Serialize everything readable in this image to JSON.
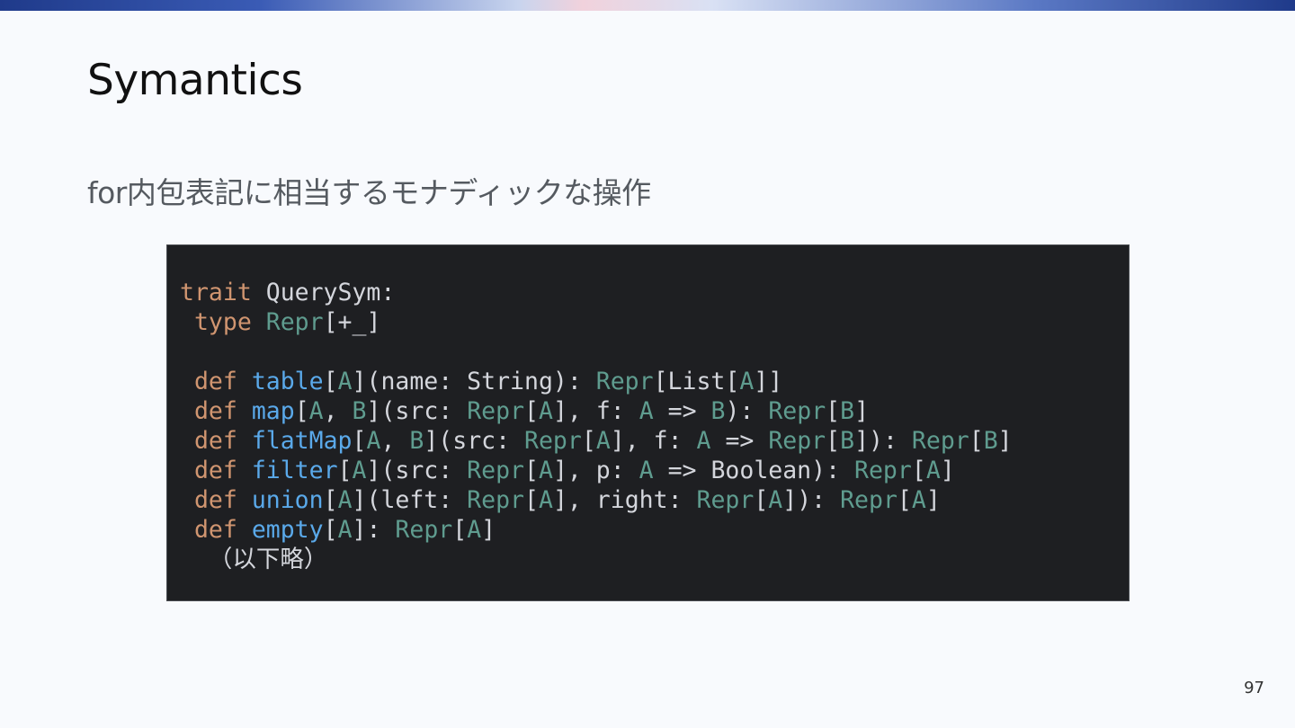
{
  "slide": {
    "title": "Symantics",
    "subtitle": "for内包表記に相当するモナディックな操作",
    "page_number": "97"
  },
  "code": {
    "lines": [
      [
        {
          "t": "trait",
          "c": "kw"
        },
        {
          "t": " QuerySym:",
          "c": "pl"
        }
      ],
      [
        {
          "t": " ",
          "c": "pl"
        },
        {
          "t": "type",
          "c": "kw"
        },
        {
          "t": " ",
          "c": "pl"
        },
        {
          "t": "Repr",
          "c": "ty"
        },
        {
          "t": "[+_]",
          "c": "pl"
        }
      ],
      [],
      [
        {
          "t": " ",
          "c": "pl"
        },
        {
          "t": "def",
          "c": "kw"
        },
        {
          "t": " ",
          "c": "pl"
        },
        {
          "t": "table",
          "c": "fn"
        },
        {
          "t": "[",
          "c": "pl"
        },
        {
          "t": "A",
          "c": "ty"
        },
        {
          "t": "](name: String): ",
          "c": "pl"
        },
        {
          "t": "Repr",
          "c": "ty"
        },
        {
          "t": "[List[",
          "c": "pl"
        },
        {
          "t": "A",
          "c": "ty"
        },
        {
          "t": "]]",
          "c": "pl"
        }
      ],
      [
        {
          "t": " ",
          "c": "pl"
        },
        {
          "t": "def",
          "c": "kw"
        },
        {
          "t": " ",
          "c": "pl"
        },
        {
          "t": "map",
          "c": "fn"
        },
        {
          "t": "[",
          "c": "pl"
        },
        {
          "t": "A",
          "c": "ty"
        },
        {
          "t": ", ",
          "c": "pl"
        },
        {
          "t": "B",
          "c": "ty"
        },
        {
          "t": "](src: ",
          "c": "pl"
        },
        {
          "t": "Repr",
          "c": "ty"
        },
        {
          "t": "[",
          "c": "pl"
        },
        {
          "t": "A",
          "c": "ty"
        },
        {
          "t": "], f: ",
          "c": "pl"
        },
        {
          "t": "A",
          "c": "ty"
        },
        {
          "t": " => ",
          "c": "pl"
        },
        {
          "t": "B",
          "c": "ty"
        },
        {
          "t": "): ",
          "c": "pl"
        },
        {
          "t": "Repr",
          "c": "ty"
        },
        {
          "t": "[",
          "c": "pl"
        },
        {
          "t": "B",
          "c": "ty"
        },
        {
          "t": "]",
          "c": "pl"
        }
      ],
      [
        {
          "t": " ",
          "c": "pl"
        },
        {
          "t": "def",
          "c": "kw"
        },
        {
          "t": " ",
          "c": "pl"
        },
        {
          "t": "flatMap",
          "c": "fn"
        },
        {
          "t": "[",
          "c": "pl"
        },
        {
          "t": "A",
          "c": "ty"
        },
        {
          "t": ", ",
          "c": "pl"
        },
        {
          "t": "B",
          "c": "ty"
        },
        {
          "t": "](src: ",
          "c": "pl"
        },
        {
          "t": "Repr",
          "c": "ty"
        },
        {
          "t": "[",
          "c": "pl"
        },
        {
          "t": "A",
          "c": "ty"
        },
        {
          "t": "], f: ",
          "c": "pl"
        },
        {
          "t": "A",
          "c": "ty"
        },
        {
          "t": " => ",
          "c": "pl"
        },
        {
          "t": "Repr",
          "c": "ty"
        },
        {
          "t": "[",
          "c": "pl"
        },
        {
          "t": "B",
          "c": "ty"
        },
        {
          "t": "]): ",
          "c": "pl"
        },
        {
          "t": "Repr",
          "c": "ty"
        },
        {
          "t": "[",
          "c": "pl"
        },
        {
          "t": "B",
          "c": "ty"
        },
        {
          "t": "]",
          "c": "pl"
        }
      ],
      [
        {
          "t": " ",
          "c": "pl"
        },
        {
          "t": "def",
          "c": "kw"
        },
        {
          "t": " ",
          "c": "pl"
        },
        {
          "t": "filter",
          "c": "fn"
        },
        {
          "t": "[",
          "c": "pl"
        },
        {
          "t": "A",
          "c": "ty"
        },
        {
          "t": "](src: ",
          "c": "pl"
        },
        {
          "t": "Repr",
          "c": "ty"
        },
        {
          "t": "[",
          "c": "pl"
        },
        {
          "t": "A",
          "c": "ty"
        },
        {
          "t": "], p: ",
          "c": "pl"
        },
        {
          "t": "A",
          "c": "ty"
        },
        {
          "t": " => Boolean): ",
          "c": "pl"
        },
        {
          "t": "Repr",
          "c": "ty"
        },
        {
          "t": "[",
          "c": "pl"
        },
        {
          "t": "A",
          "c": "ty"
        },
        {
          "t": "]",
          "c": "pl"
        }
      ],
      [
        {
          "t": " ",
          "c": "pl"
        },
        {
          "t": "def",
          "c": "kw"
        },
        {
          "t": " ",
          "c": "pl"
        },
        {
          "t": "union",
          "c": "fn"
        },
        {
          "t": "[",
          "c": "pl"
        },
        {
          "t": "A",
          "c": "ty"
        },
        {
          "t": "](left: ",
          "c": "pl"
        },
        {
          "t": "Repr",
          "c": "ty"
        },
        {
          "t": "[",
          "c": "pl"
        },
        {
          "t": "A",
          "c": "ty"
        },
        {
          "t": "], right: ",
          "c": "pl"
        },
        {
          "t": "Repr",
          "c": "ty"
        },
        {
          "t": "[",
          "c": "pl"
        },
        {
          "t": "A",
          "c": "ty"
        },
        {
          "t": "]): ",
          "c": "pl"
        },
        {
          "t": "Repr",
          "c": "ty"
        },
        {
          "t": "[",
          "c": "pl"
        },
        {
          "t": "A",
          "c": "ty"
        },
        {
          "t": "]",
          "c": "pl"
        }
      ],
      [
        {
          "t": " ",
          "c": "pl"
        },
        {
          "t": "def",
          "c": "kw"
        },
        {
          "t": " ",
          "c": "pl"
        },
        {
          "t": "empty",
          "c": "fn"
        },
        {
          "t": "[",
          "c": "pl"
        },
        {
          "t": "A",
          "c": "ty"
        },
        {
          "t": "]: ",
          "c": "pl"
        },
        {
          "t": "Repr",
          "c": "ty"
        },
        {
          "t": "[",
          "c": "pl"
        },
        {
          "t": "A",
          "c": "ty"
        },
        {
          "t": "]",
          "c": "pl"
        }
      ],
      [
        {
          "t": "  （以下略）",
          "c": "pl"
        }
      ]
    ]
  },
  "colors": {
    "background": "#f8fafd",
    "code_background": "#1e1f22",
    "keyword": "#d09570",
    "function": "#5aa9ea",
    "type": "#5f9c8f",
    "plain": "#d4d6dc"
  }
}
